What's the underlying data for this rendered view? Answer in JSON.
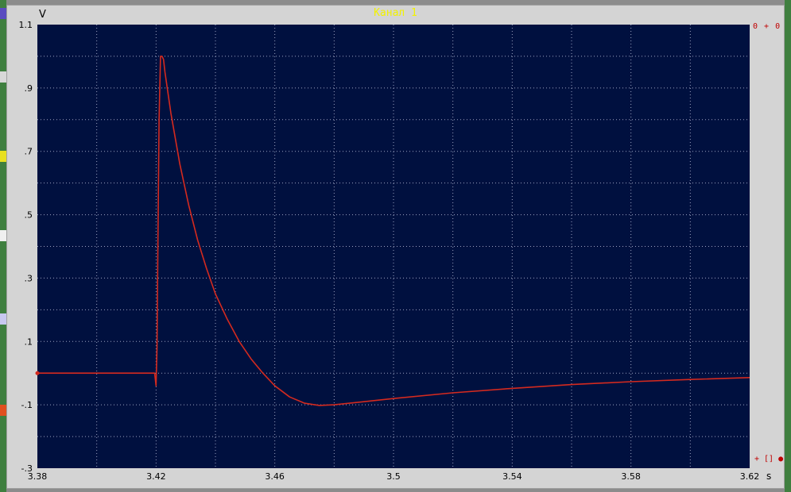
{
  "window": {
    "title": "Канал 1",
    "y_unit": "V",
    "x_unit": "s",
    "controls_top": "0 + 0",
    "controls_bottom": "+ [] ●"
  },
  "colors": {
    "plot_background": "#00103f",
    "grid": "#9aa2c0",
    "trace": "#d42a1f",
    "title": "#f2f200"
  },
  "chart_data": {
    "type": "line",
    "title": "Канал 1",
    "xlabel": "s",
    "ylabel": "V",
    "xlim": [
      3.38,
      3.62
    ],
    "ylim": [
      -0.3,
      1.1
    ],
    "x_ticks": [
      "3.38",
      "3.42",
      "3.46",
      "3.5",
      "3.54",
      "3.58",
      "3.62"
    ],
    "y_ticks": [
      "1.1",
      ".9",
      ".7",
      ".5",
      ".3",
      ".1",
      "-.1",
      "-.3"
    ],
    "grid": true,
    "series": [
      {
        "x": [
          3.38,
          3.39,
          3.4,
          3.41,
          3.4195,
          3.42,
          3.4203,
          3.4206,
          3.421,
          3.4215,
          3.422,
          3.4225,
          3.423,
          3.425,
          3.428,
          3.431,
          3.434,
          3.437,
          3.44,
          3.444,
          3.448,
          3.452,
          3.456,
          3.46,
          3.465,
          3.47,
          3.475,
          3.48,
          3.49,
          3.5,
          3.52,
          3.54,
          3.56,
          3.58,
          3.6,
          3.62
        ],
        "y": [
          0.0,
          0.0,
          0.0,
          0.0,
          0.0,
          -0.04,
          0.08,
          0.4,
          0.8,
          1.0,
          1.0,
          0.99,
          0.95,
          0.82,
          0.66,
          0.53,
          0.42,
          0.33,
          0.25,
          0.17,
          0.1,
          0.045,
          0.0,
          -0.04,
          -0.075,
          -0.095,
          -0.102,
          -0.1,
          -0.09,
          -0.08,
          -0.062,
          -0.048,
          -0.036,
          -0.027,
          -0.02,
          -0.014
        ]
      }
    ]
  }
}
